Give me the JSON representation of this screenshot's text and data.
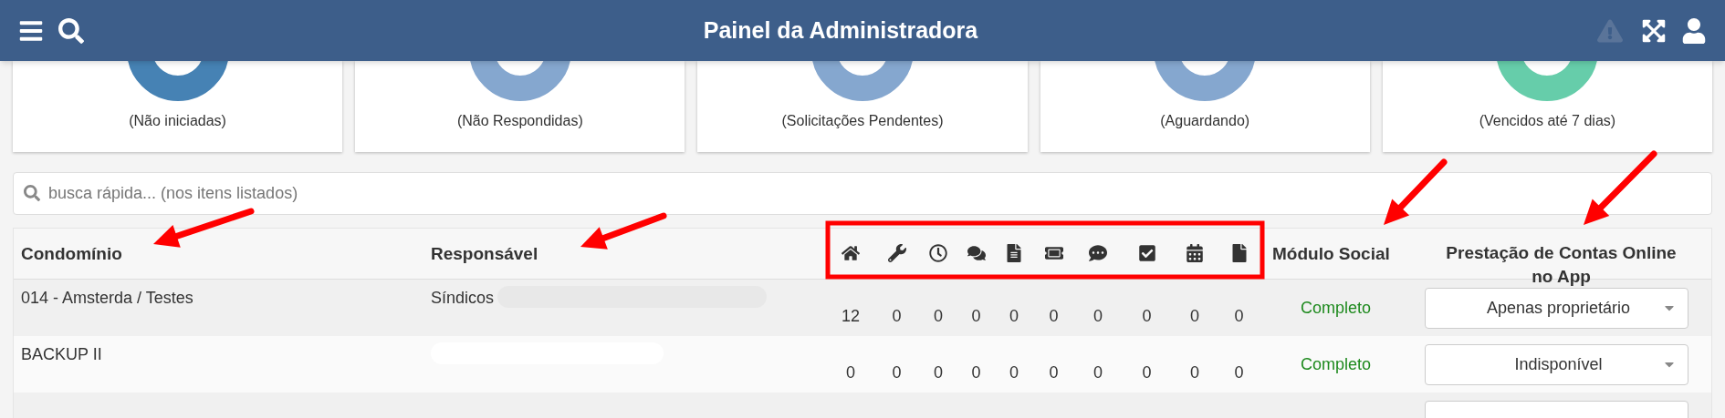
{
  "header": {
    "title": "Painel da Administradora",
    "warning_disabled": true
  },
  "cards": [
    {
      "label": "(Não iniciadas)",
      "color": "#4682b4"
    },
    {
      "label": "(Não Respondidas)",
      "color": "#85a7cf"
    },
    {
      "label": "(Solicitações Pendentes)",
      "color": "#85a7cf"
    },
    {
      "label": "(Aguardando)",
      "color": "#85a7cf"
    },
    {
      "label": "(Vencidos até 7 dias)",
      "color": "#66cdaa"
    }
  ],
  "search": {
    "placeholder": "busca rápida... (nos itens listados)"
  },
  "table": {
    "columns": [
      "Condomínio",
      "Responsável",
      "Módulo Social",
      "Prestação de Contas Online no App"
    ],
    "icon_columns": [
      {
        "kind": "home"
      },
      {
        "kind": "wrench"
      },
      {
        "kind": "clock"
      },
      {
        "kind": "chats"
      },
      {
        "kind": "document"
      },
      {
        "kind": "ticket"
      },
      {
        "kind": "comment"
      },
      {
        "kind": "check"
      },
      {
        "kind": "calendar"
      },
      {
        "kind": "file"
      }
    ],
    "rows": [
      {
        "condominio": "014 - Amsterda / Testes",
        "responsavel": "Síndicos",
        "redacted": true,
        "counts": [
          "12",
          "0",
          "0",
          "0",
          "0",
          "0",
          "0",
          "0",
          "0",
          "0"
        ],
        "social": "Completo",
        "prestacao": "Apenas proprietário"
      },
      {
        "condominio": "BACKUP II",
        "redacted": true,
        "counts": [
          "0",
          "0",
          "0",
          "0",
          "0",
          "0",
          "0",
          "0",
          "0",
          "0"
        ],
        "social": "Completo",
        "prestacao": "Indisponível"
      }
    ],
    "cut_row": {
      "has_select": true
    }
  }
}
